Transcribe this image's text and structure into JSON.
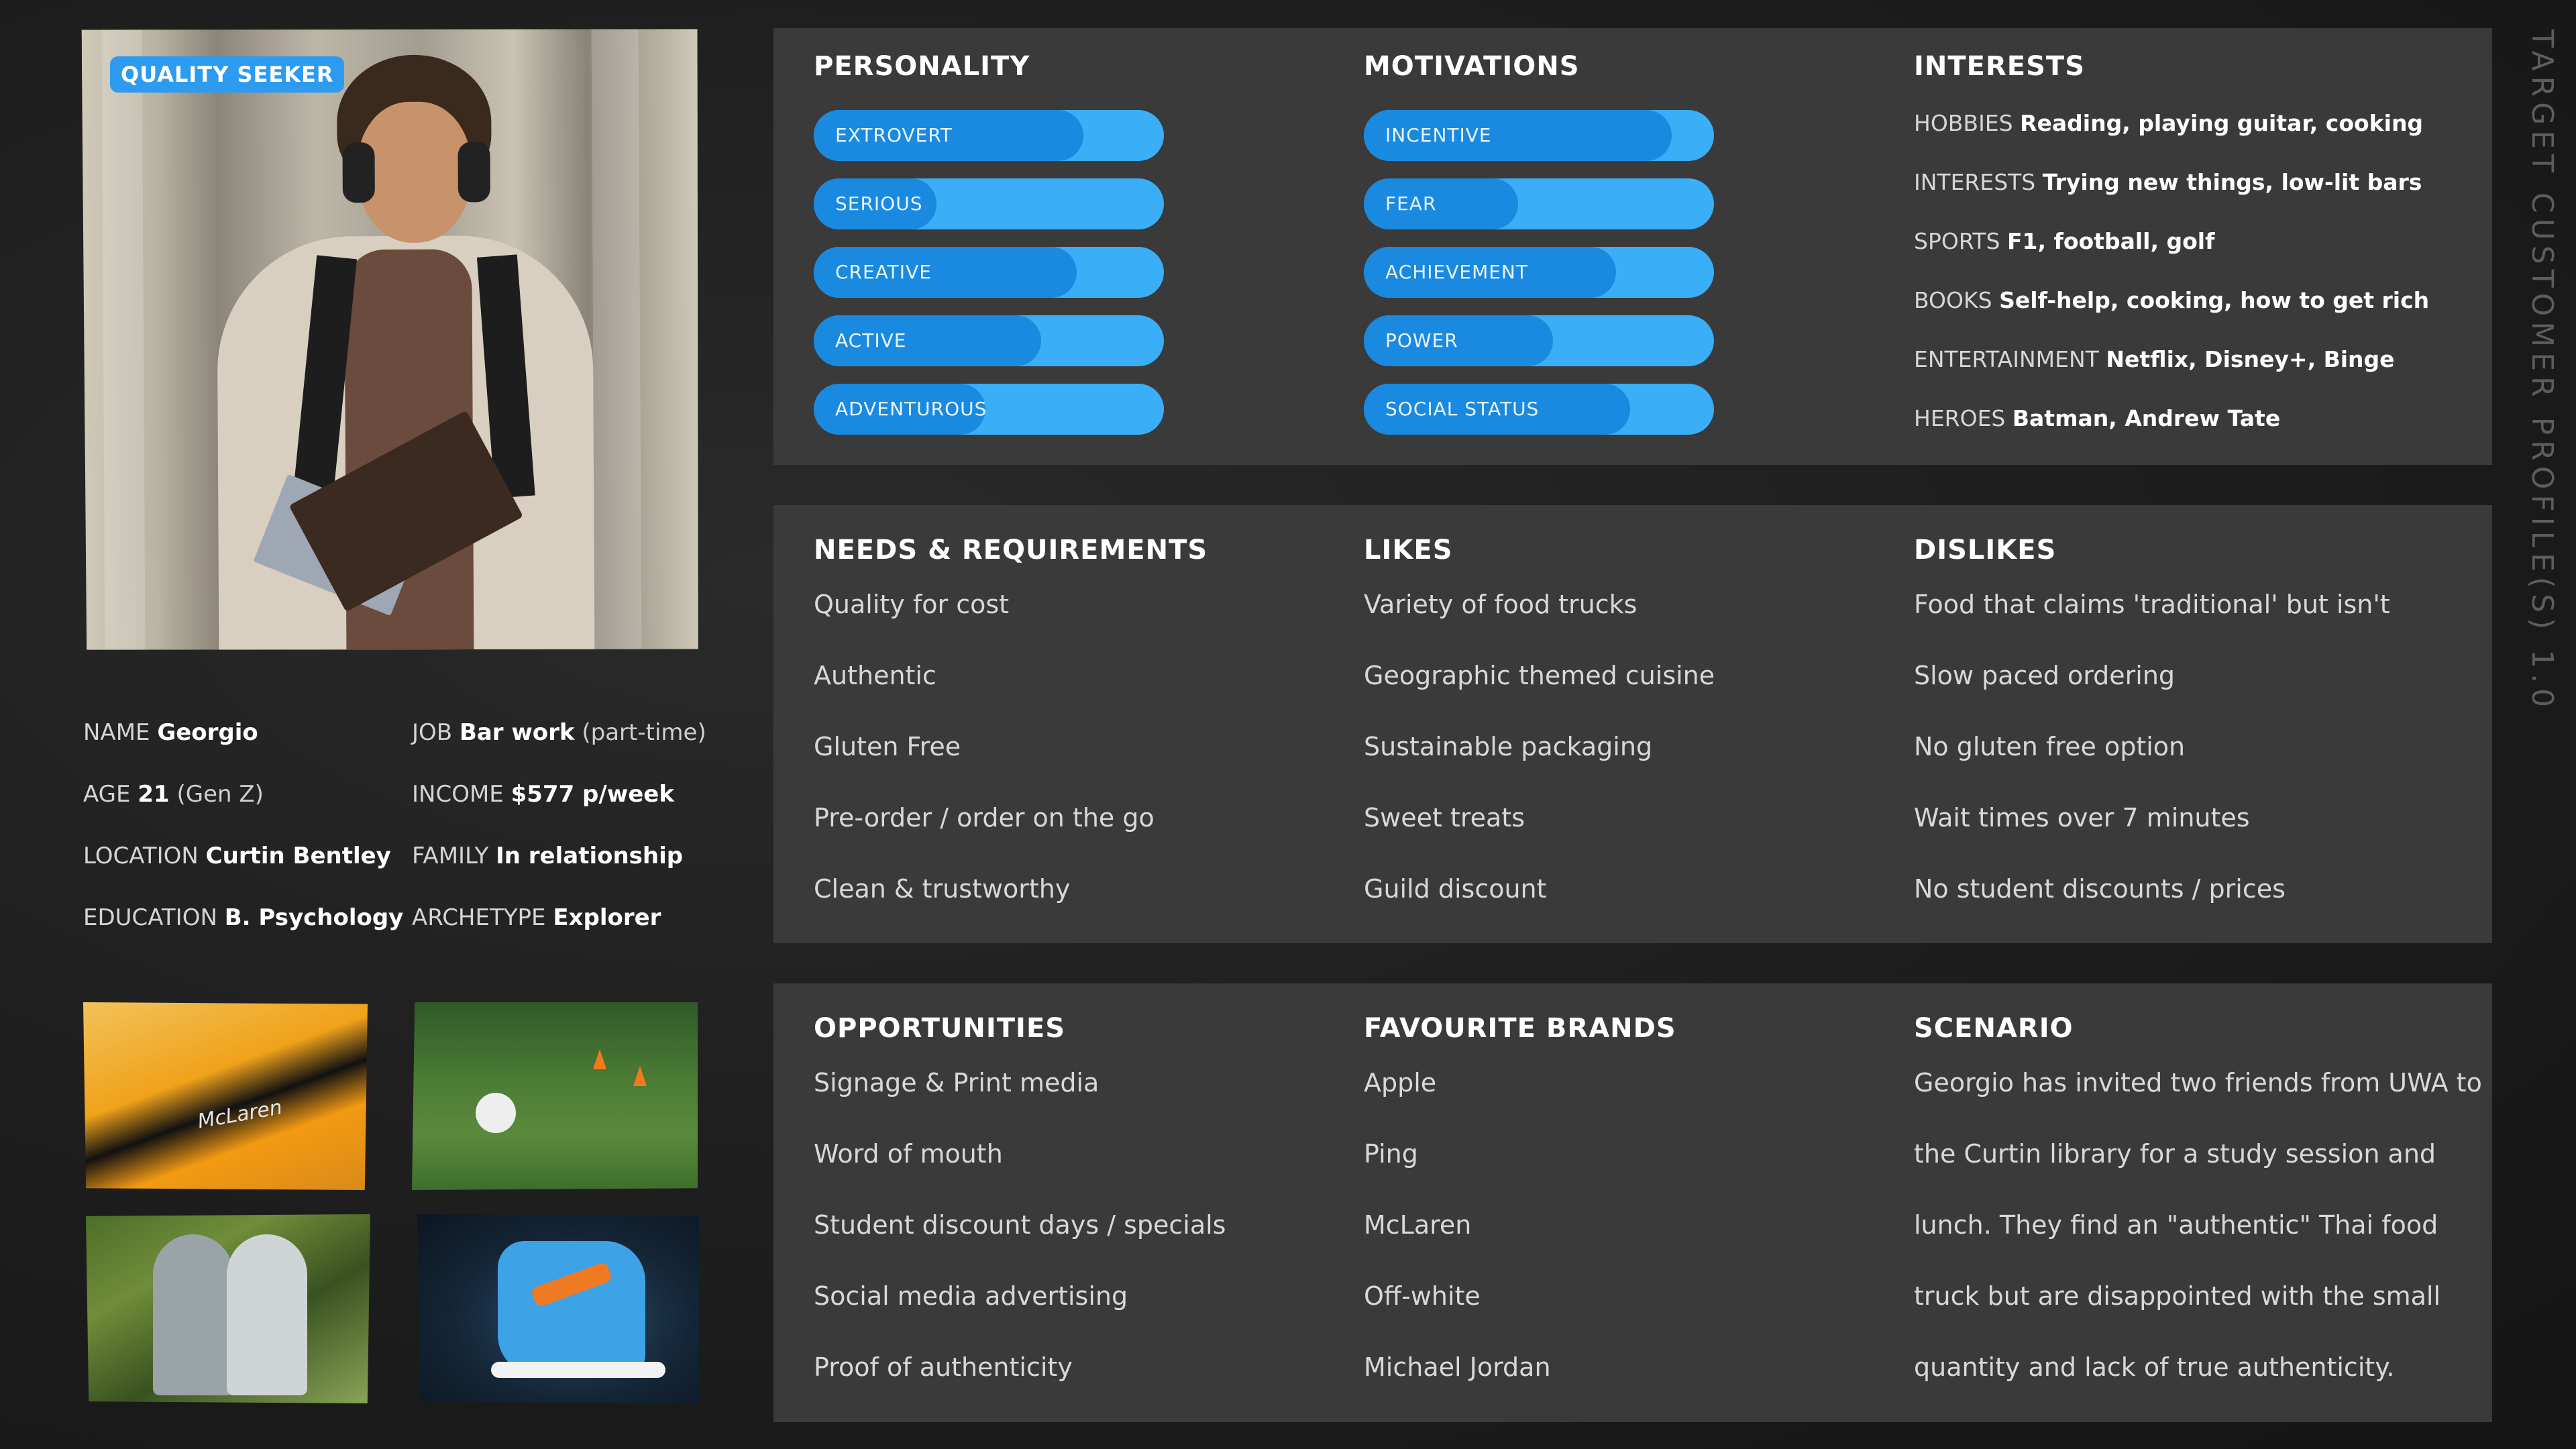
{
  "side_title": "TARGET CUSTOMER PROFILE(S) 1.0",
  "badge": "QUALITY SEEKER",
  "profile": {
    "name": {
      "label": "NAME",
      "value": "Georgio",
      "suffix": ""
    },
    "job": {
      "label": "JOB",
      "value": "Bar work",
      "suffix": "(part-time)"
    },
    "age": {
      "label": "AGE",
      "value": "21",
      "suffix": "(Gen Z)"
    },
    "income": {
      "label": "INCOME",
      "value": "$577 p/week",
      "suffix": ""
    },
    "location": {
      "label": "LOCATION",
      "value": "Curtin Bentley",
      "suffix": ""
    },
    "family": {
      "label": "FAMILY",
      "value": "In relationship",
      "suffix": ""
    },
    "education": {
      "label": "EDUCATION",
      "value": "B. Psychology",
      "suffix": ""
    },
    "archetype": {
      "label": "ARCHETYPE",
      "value": "Explorer",
      "suffix": ""
    }
  },
  "thumb_mclaren_text": "McLaren",
  "personality": {
    "title": "PERSONALITY",
    "bars": [
      {
        "label": "EXTROVERT",
        "level": 0.77
      },
      {
        "label": "SERIOUS",
        "level": 0.35
      },
      {
        "label": "CREATIVE",
        "level": 0.75
      },
      {
        "label": "ACTIVE",
        "level": 0.65
      },
      {
        "label": "ADVENTUROUS",
        "level": 0.49
      }
    ]
  },
  "motivations": {
    "title": "MOTIVATIONS",
    "bars": [
      {
        "label": "INCENTIVE",
        "level": 0.88
      },
      {
        "label": "FEAR",
        "level": 0.44
      },
      {
        "label": "ACHIEVEMENT",
        "level": 0.72
      },
      {
        "label": "POWER",
        "level": 0.54
      },
      {
        "label": "SOCIAL STATUS",
        "level": 0.76
      }
    ]
  },
  "interests": {
    "title": "INTERESTS",
    "rows": [
      {
        "label": "HOBBIES",
        "value": "Reading, playing guitar, cooking"
      },
      {
        "label": "INTERESTS",
        "value": "Trying new things, low-lit bars"
      },
      {
        "label": "SPORTS",
        "value": "F1, football, golf"
      },
      {
        "label": "BOOKS",
        "value": "Self-help, cooking, how to get rich"
      },
      {
        "label": "ENTERTAINMENT",
        "value": "Netflix, Disney+, Binge"
      },
      {
        "label": "HEROES",
        "value": "Batman, Andrew Tate"
      }
    ]
  },
  "needs": {
    "title": "NEEDS & REQUIREMENTS",
    "items": [
      "Quality for cost",
      "Authentic",
      "Gluten Free",
      "Pre-order / order on the go",
      "Clean & trustworthy"
    ]
  },
  "likes": {
    "title": "LIKES",
    "items": [
      "Variety of food trucks",
      "Geographic themed cuisine",
      "Sustainable packaging",
      "Sweet treats",
      "Guild discount"
    ]
  },
  "dislikes": {
    "title": "DISLIKES",
    "items": [
      "Food that claims 'traditional' but isn't",
      "Slow paced ordering",
      "No gluten free option",
      "Wait times over 7 minutes",
      "No student discounts / prices"
    ]
  },
  "opportunities": {
    "title": "OPPORTUNITIES",
    "items": [
      "Signage & Print media",
      "Word of mouth",
      "Student discount days / specials",
      "Social media advertising",
      "Proof of authenticity"
    ]
  },
  "brands": {
    "title": "FAVOURITE BRANDS",
    "items": [
      "Apple",
      "Ping",
      "McLaren",
      "Off-white",
      "Michael Jordan"
    ]
  },
  "scenario": {
    "title": "SCENARIO",
    "lines": [
      "Georgio has invited two friends from UWA to",
      "the Curtin library for a study session and",
      "lunch. They find an \"authentic\" Thai food",
      "truck but are disappointed with the small",
      "quantity and lack of true authenticity."
    ]
  }
}
